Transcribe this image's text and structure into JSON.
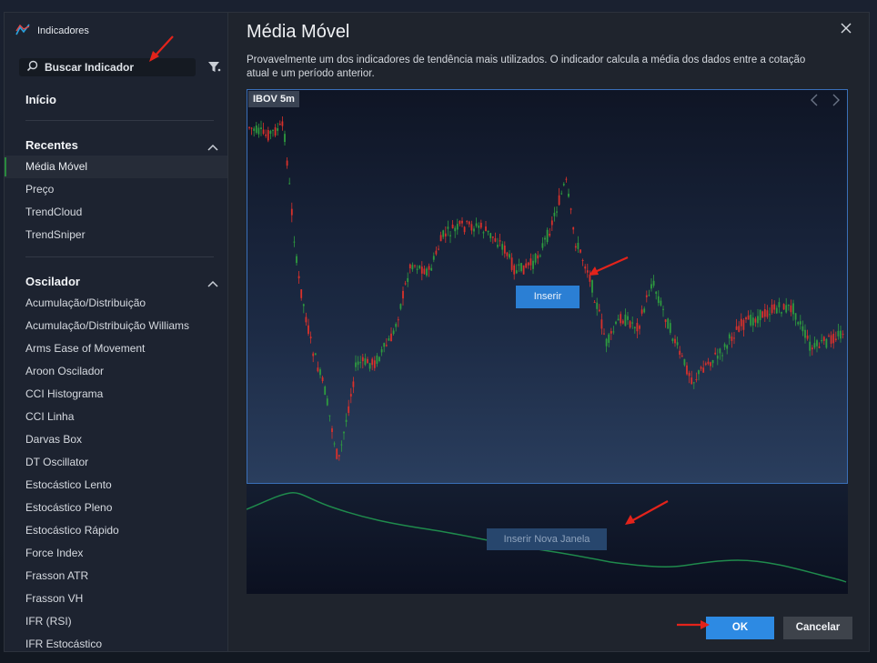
{
  "sidebar": {
    "header": "Indicadores",
    "search_placeholder": "Buscar Indicador",
    "home": "Início",
    "sections": [
      {
        "title": "Recentes",
        "items": [
          "Média Móvel",
          "Preço",
          "TrendCloud",
          "TrendSniper"
        ]
      },
      {
        "title": "Oscilador",
        "items": [
          "Acumulação/Distribuição",
          "Acumulação/Distribuição Williams",
          "Arms Ease of Movement",
          "Aroon Oscilador",
          "CCI Histograma",
          "CCI Linha",
          "Darvas Box",
          "DT Oscillator",
          "Estocástico Lento",
          "Estocástico Pleno",
          "Estocástico Rápido",
          "Force Index",
          "Frasson ATR",
          "Frasson VH",
          "IFR (RSI)",
          "IFR Estocástico"
        ]
      }
    ],
    "active_item": "Média Móvel"
  },
  "main": {
    "title": "Média Móvel",
    "description": "Provavelmente um dos indicadores de tendência mais utilizados. O indicador calcula a média dos dados entre a cotação atual e um período anterior.",
    "preview": {
      "symbol_tag": "IBOV 5m",
      "insert_button": "Inserir",
      "insert_new_window_button": "Inserir Nova Janela"
    },
    "ok_button": "OK",
    "cancel_button": "Cancelar"
  },
  "colors": {
    "accent": "#2d8ae3",
    "candle_up": "#2e9b3f",
    "candle_down": "#d9312b",
    "moving_average_line": "#1f8a4c",
    "annotation_arrow": "#e3231b"
  },
  "icons": {
    "header": "indicators-logo-icon",
    "search": "search-icon",
    "filter": "filter-icon",
    "close": "close-icon",
    "collapse": "chevron-up-icon"
  }
}
